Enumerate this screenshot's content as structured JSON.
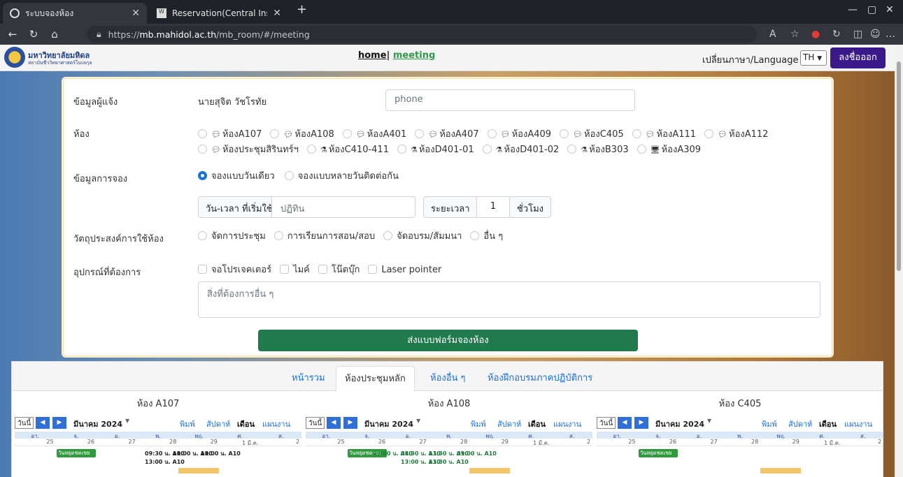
{
  "browser": {
    "tabs": [
      {
        "title": "ระบบจองห้อง",
        "active": true
      },
      {
        "title": "Reservation(Central Instrument)",
        "active": false
      }
    ],
    "url_prefix": "https://",
    "url_host": "mb.mahidol.ac.th",
    "url_path": "/mb_room/#/meeting"
  },
  "header": {
    "logo_name": "มหาวิทยาลัยมหิดล",
    "logo_sub": "สถาบันชีววิทยาศาสตร์โมเลกุล",
    "nav_home": "home",
    "nav_sep": "|",
    "nav_meeting": "meeting",
    "lang_label": "เปลี่ยนภาษา/Language",
    "lang_value": "TH",
    "logout": "ลงชื่อออก"
  },
  "form": {
    "reporter_label": "ข้อมูลผู้แจ้ง",
    "reporter_name": "นายสุจิต วัชโรทัย",
    "phone_placeholder": "phone",
    "room_label": "ห้อง",
    "rooms_row1": [
      "ห้องA107",
      "ห้องA108",
      "ห้องA401",
      "ห้องA407",
      "ห้องA409",
      "ห้องC405",
      "ห้องA111",
      "ห้องA112"
    ],
    "rooms_row2": [
      "ห้องประชุมสิรินทร์ฯ",
      "ห้องC410-411",
      "ห้องD401-01",
      "ห้องD401-02",
      "ห้องB303",
      "ห้องA309"
    ],
    "booking_label": "ข้อมูลการจอง",
    "booking_single": "จองแบบวันเดียว",
    "booking_multi": "จองแบบหลายวันติดต่อกัน",
    "start_label": "วัน-เวลา ที่เริ่มใช้ห้อง",
    "start_placeholder": "ปฏิทิน",
    "duration_label": "ระยะเวลา",
    "duration_value": "1",
    "duration_unit": "ชั่วโมง",
    "purpose_label": "วัตถุประสงค์การใช้ห้อง",
    "purposes": [
      "จัดการประชุม",
      "การเรียนการสอน/สอบ",
      "จัดอบรม/สัมมนา",
      "อื่น ๆ"
    ],
    "equipment_label": "อุปกรณ์ที่ต้องการ",
    "equipment": [
      "จอโปรเจคเตอร์",
      "ไมค์",
      "โน๊ตบุ๊ก",
      "Laser pointer"
    ],
    "other_placeholder": "สิ่งที่ต้องการอื่น ๆ",
    "submit": "ส่งแบบฟอร์มจองห้อง"
  },
  "tabs": {
    "items": [
      "หน้ารวม",
      "ห้องประชุมหลัก",
      "ห้องอื่น ๆ",
      "ห้องฝึกอบรมภาคปฏิบัติการ"
    ],
    "active": "ห้องประชุมหลัก"
  },
  "calendar_common": {
    "today": "วันนี้",
    "month": "มีนาคม 2024",
    "print": "พิมพ์",
    "week": "สัปดาห์",
    "month_view": "เดือน",
    "agenda": "แผนงาน",
    "weekdays": [
      "อา.",
      "จ.",
      "อ.",
      "พ.",
      "พฤ.",
      "ศ.",
      "ส."
    ],
    "days": [
      "25",
      "26",
      "27",
      "28",
      "29",
      "1 มี.ค.",
      "2"
    ],
    "holiday": "วันหยุดชดเชย"
  },
  "calendars": [
    {
      "title": "ห้อง A107",
      "events": [
        "09:30 น. A10",
        "10:00 น. A10",
        "10:00 น. A10",
        "13:00 น. A10"
      ]
    },
    {
      "title": "ห้อง A108",
      "events": [
        "09:00 น. A10",
        "08:30 น. A10",
        "13:30 น. A10",
        "09:00 น. A10",
        "13:00 น. A10",
        "13:30 น. A10"
      ]
    },
    {
      "title": "ห้อง C405",
      "events": []
    }
  ]
}
